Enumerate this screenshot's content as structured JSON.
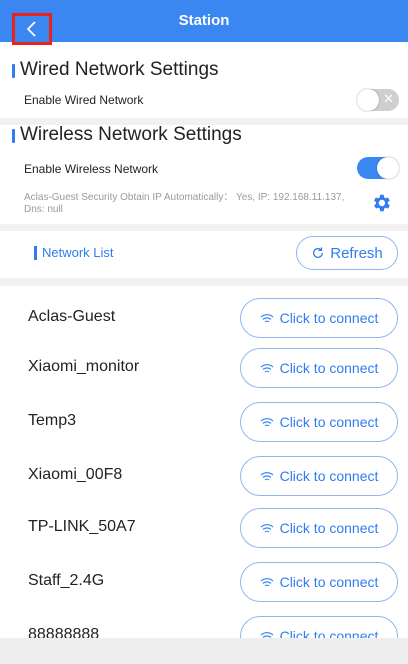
{
  "header": {
    "title": "Station"
  },
  "wired": {
    "section_title": "Wired Network Settings",
    "enable_label": "Enable Wired Network",
    "enabled": false
  },
  "wireless": {
    "section_title": "Wireless Network Settings",
    "enable_label": "Enable Wireless Network",
    "enabled": true,
    "status_text": "Aclas-Guest Security Obtain IP Automatically： Yes, IP: 192.168.11.137, Dns: null"
  },
  "network_list": {
    "label": "Network List",
    "refresh_label": "Refresh",
    "connect_label": "Click to connect",
    "networks": [
      {
        "name": "Aclas-Guest"
      },
      {
        "name": "Xiaomi_monitor"
      },
      {
        "name": "Temp3"
      },
      {
        "name": "Xiaomi_00F8"
      },
      {
        "name": "TP-LINK_50A7"
      },
      {
        "name": "Staff_2.4G"
      },
      {
        "name": "88888888"
      }
    ]
  },
  "colors": {
    "accent": "#3b87f2",
    "highlight": "#e8231e"
  },
  "icons": {
    "back": "chevron-left-icon",
    "gear": "gear-icon",
    "refresh": "refresh-icon",
    "wifi": "wifi-icon"
  }
}
